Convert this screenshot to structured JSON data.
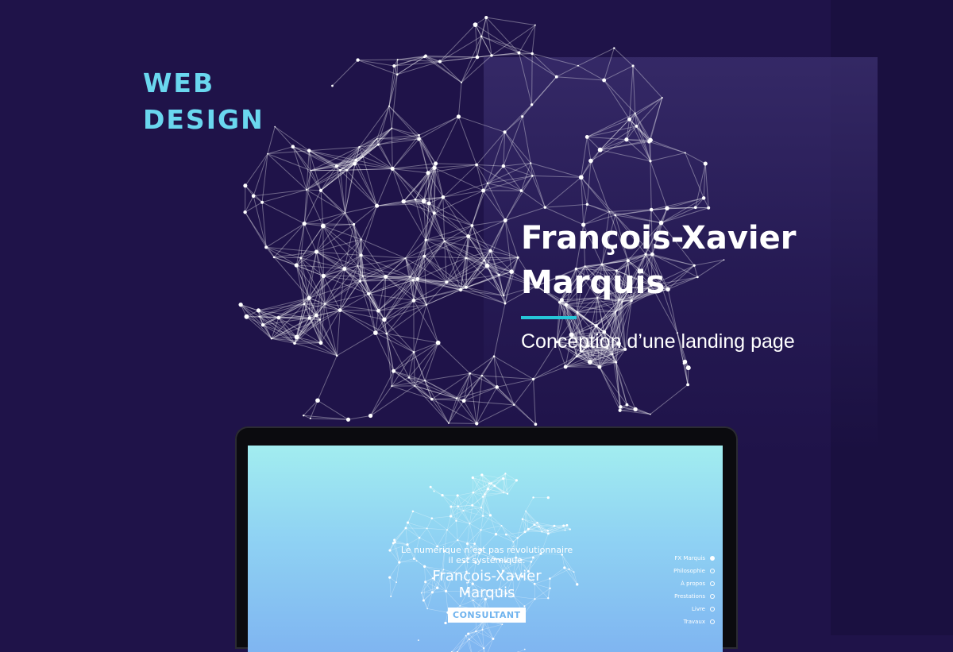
{
  "category": {
    "line1": "WEB",
    "line2": "DESIGN"
  },
  "hero": {
    "name_line1": "François-Xavier",
    "name_line2": "Marquis",
    "subtitle": "Conception d’une landing page"
  },
  "mockup": {
    "tagline_line1": "Le numérique n’est pas révolutionnaire",
    "tagline_line2": "il est systémique.",
    "name_line1": "François-Xavier",
    "name_line2": "Marquis",
    "badge": "CONSULTANT",
    "nav": [
      {
        "label": "FX Marquis",
        "active": true
      },
      {
        "label": "Philosophie",
        "active": false
      },
      {
        "label": "À propos",
        "active": false
      },
      {
        "label": "Prestations",
        "active": false
      },
      {
        "label": "Livre",
        "active": false
      },
      {
        "label": "Travaux",
        "active": false
      }
    ]
  },
  "colors": {
    "background": "#1f1349",
    "accent": "#26c6d8",
    "category": "#6ad7ef"
  }
}
